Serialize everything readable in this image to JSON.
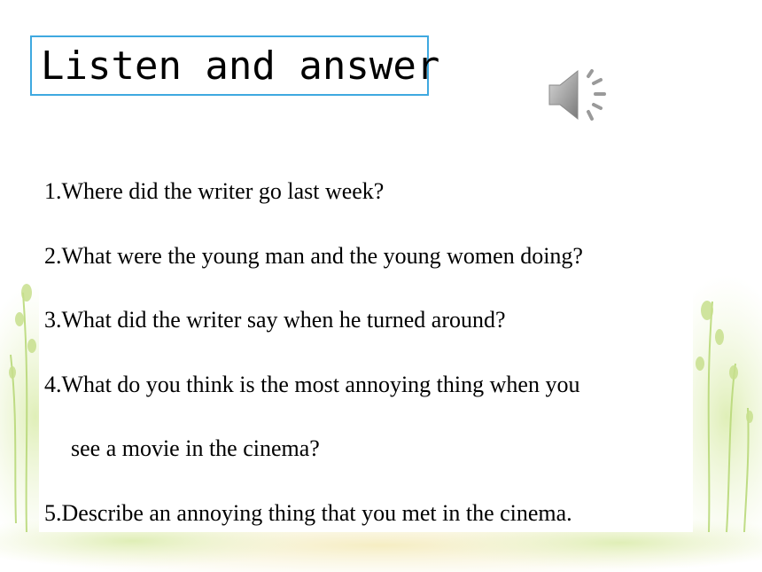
{
  "slide": {
    "title": "Listen and answer",
    "speaker_icon": "speaker-sound-icon",
    "questions": [
      "1.Where did the writer go last week?",
      "2.What were the young man and the young women doing?",
      "3.What did the writer say when he turned around?",
      "4.What do you think is the most annoying thing when you",
      "see a movie in the cinema?",
      "5.Describe an annoying thing that you met in the cinema."
    ],
    "colors": {
      "title_border": "#3fa9e0",
      "leaf_green": "#b9d97a"
    }
  }
}
